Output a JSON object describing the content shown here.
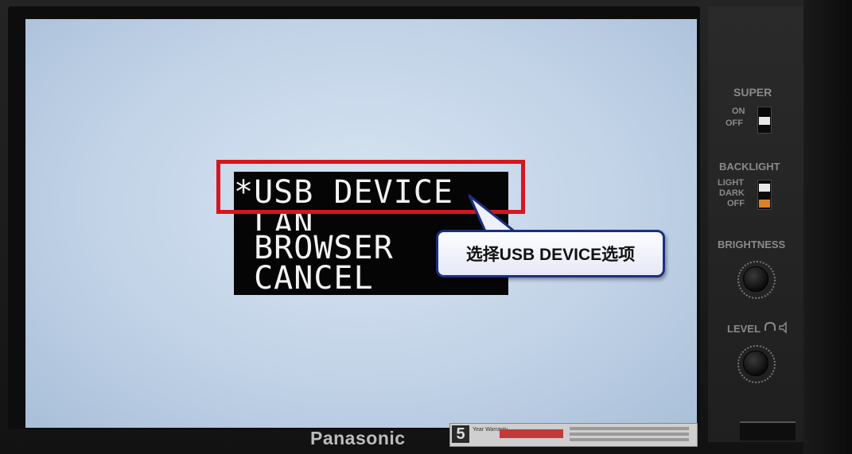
{
  "osd_menu": {
    "items": [
      {
        "label": "*USB DEVICE",
        "selected": true
      },
      {
        "label": " LAN",
        "selected": false
      },
      {
        "label": " BROWSER",
        "selected": false
      },
      {
        "label": " CANCEL",
        "selected": false
      }
    ]
  },
  "annotation": {
    "callout_text": "选择USB DEVICE选项",
    "highlight_color": "#d5161e",
    "callout_border_color": "#1b2f82"
  },
  "monitor": {
    "brand": "Panasonic",
    "warranty_years": "5",
    "warranty_text": "Year Warranty"
  },
  "side_panel": {
    "super_label": "SUPER",
    "super_on": "ON",
    "super_off": "OFF",
    "backlight_label": "BACKLIGHT",
    "backlight_light": "LIGHT",
    "backlight_dark": "DARK",
    "backlight_off": "OFF",
    "brightness_label": "BRIGHTNESS",
    "level_label": "LEVEL",
    "level_icons": "headphone-icon speaker-icon"
  },
  "colors": {
    "screen": "#c6d6e9",
    "osd_background": "#050505",
    "osd_text": "#f2f2f2"
  }
}
